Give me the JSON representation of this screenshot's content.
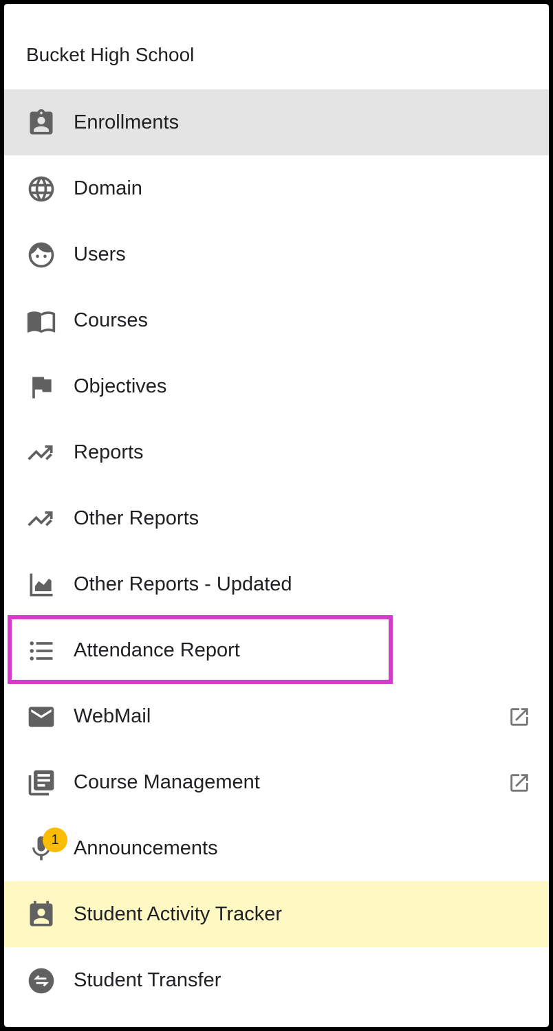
{
  "sidebar": {
    "school_name": "Bucket High School",
    "items": [
      {
        "label": "Enrollments",
        "icon": "badge-icon",
        "state": "active"
      },
      {
        "label": "Domain",
        "icon": "globe-icon"
      },
      {
        "label": "Users",
        "icon": "face-icon"
      },
      {
        "label": "Courses",
        "icon": "book-icon"
      },
      {
        "label": "Objectives",
        "icon": "flag-icon"
      },
      {
        "label": "Reports",
        "icon": "trending-icon"
      },
      {
        "label": "Other Reports",
        "icon": "trending-icon"
      },
      {
        "label": "Other Reports - Updated",
        "icon": "area-chart-icon"
      },
      {
        "label": "Attendance Report",
        "icon": "list-icon",
        "state": "outlined"
      },
      {
        "label": "WebMail",
        "icon": "mail-icon",
        "external": true
      },
      {
        "label": "Course Management",
        "icon": "library-icon",
        "external": true
      },
      {
        "label": "Announcements",
        "icon": "mic-icon",
        "badge": "1"
      },
      {
        "label": "Student Activity Tracker",
        "icon": "badge-icon",
        "state": "highlighted"
      },
      {
        "label": "Student Transfer",
        "icon": "swap-icon"
      }
    ]
  },
  "colors": {
    "active_bg": "#e4e4e4",
    "highlight_bg": "#fef9c3",
    "outline": "#d63ccc",
    "badge": "#fbbc04",
    "icon": "#616161"
  }
}
